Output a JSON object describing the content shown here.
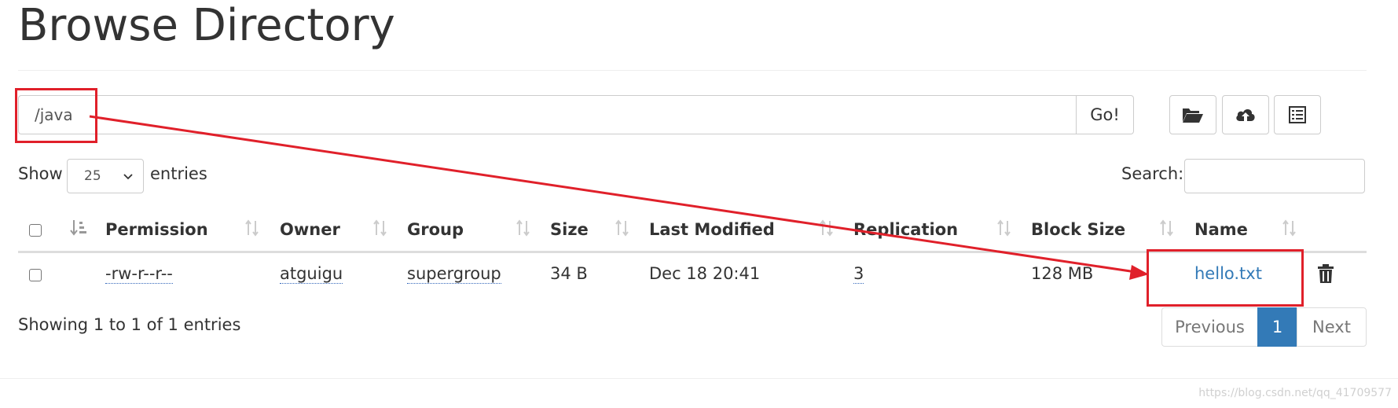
{
  "page": {
    "title": "Browse Directory"
  },
  "path_bar": {
    "value": "/java",
    "go_label": "Go!"
  },
  "toolbar": {
    "icons": [
      "folder-open-icon",
      "cloud-upload-icon",
      "list-icon"
    ]
  },
  "entries_control": {
    "show_label": "Show",
    "selected": "25",
    "entries_label": "entries"
  },
  "search": {
    "label": "Search:",
    "value": ""
  },
  "table": {
    "columns": [
      "Permission",
      "Owner",
      "Group",
      "Size",
      "Last Modified",
      "Replication",
      "Block Size",
      "Name"
    ],
    "rows": [
      {
        "permission": "-rw-r--r--",
        "owner": "atguigu",
        "group": "supergroup",
        "size": "34 B",
        "last_modified": "Dec 18 20:41",
        "replication": "3",
        "block_size": "128 MB",
        "name": "hello.txt"
      }
    ]
  },
  "footer": {
    "info": "Showing 1 to 1 of 1 entries",
    "previous_label": "Previous",
    "current_page": "1",
    "next_label": "Next"
  },
  "watermark": "https://blog.csdn.net/qq_41709577",
  "colors": {
    "link": "#337ab7",
    "active_page": "#337ab7",
    "annotation": "#e0202a"
  }
}
